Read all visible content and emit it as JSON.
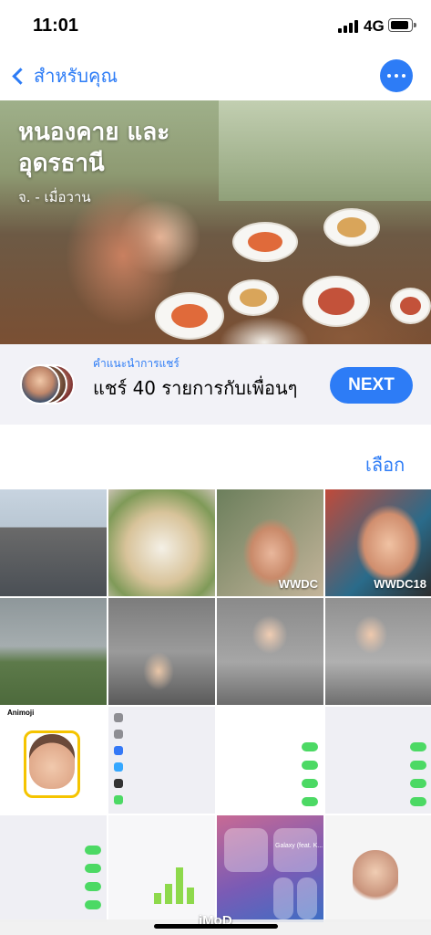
{
  "status_bar": {
    "time": "11:01",
    "network": "4G",
    "signal_bars": 4,
    "battery_level": 0.8
  },
  "nav": {
    "back_label": "สำหรับคุณ",
    "back_icon": "chevron-left-icon",
    "more_icon": "ellipsis-icon"
  },
  "memory": {
    "title": "หนองคาย และ อุดรธานี",
    "subtitle": "จ. - เมื่อวาน"
  },
  "sharing_suggestion": {
    "eyebrow": "คำแนะนำการแชร์",
    "title": "แชร์ 40 รายการกับเพื่อนๆ",
    "next_label": "NEXT"
  },
  "select_label": "เลือก",
  "photos": [
    {
      "id": "photo-1"
    },
    {
      "id": "photo-2"
    },
    {
      "id": "photo-3",
      "watermark": "WWDC"
    },
    {
      "id": "photo-4",
      "watermark": "WWDC18"
    },
    {
      "id": "photo-5"
    },
    {
      "id": "photo-6"
    },
    {
      "id": "photo-7"
    },
    {
      "id": "photo-8"
    },
    {
      "id": "screenshot-1",
      "label": "Animoji"
    },
    {
      "id": "screenshot-2"
    },
    {
      "id": "screenshot-3"
    },
    {
      "id": "screenshot-4"
    },
    {
      "id": "screenshot-5"
    },
    {
      "id": "screenshot-6"
    },
    {
      "id": "screenshot-7",
      "label": "Galaxy (feat. K..."
    },
    {
      "id": "photo-9"
    }
  ],
  "watermark_overlay": "iMoD",
  "colors": {
    "accent": "#2d7cf6",
    "toggle_on": "#4cd964",
    "card_background": "#f2f2f7"
  }
}
